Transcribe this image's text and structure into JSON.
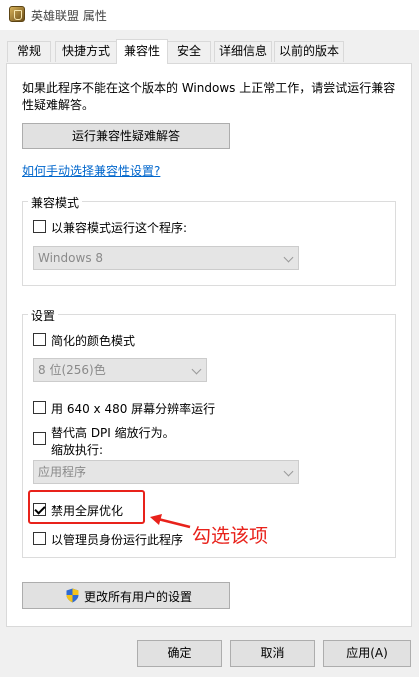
{
  "window": {
    "title": "英雄联盟 属性",
    "app_icon": "lol-icon"
  },
  "tabs": [
    "常规",
    "快捷方式",
    "兼容性",
    "安全",
    "详细信息",
    "以前的版本"
  ],
  "active_tab": "兼容性",
  "description": "如果此程序不能在这个版本的 Windows 上正常工作，请尝试运行兼容性疑难解答。",
  "troubleshooter_button": "运行兼容性疑难解答",
  "manual_link": "如何手动选择兼容性设置?",
  "compat_mode": {
    "group_label": "兼容模式",
    "checkbox_label": "以兼容模式运行这个程序:",
    "checked": false,
    "select_value": "Windows 8"
  },
  "settings": {
    "group_label": "设置",
    "reduced_color": {
      "label": "简化的颜色模式",
      "checked": false,
      "select_value": "8 位(256)色"
    },
    "res_640": {
      "label": "用 640 x 480 屏幕分辨率运行",
      "checked": false
    },
    "dpi": {
      "label_line1": "替代高 DPI 缩放行为。",
      "label_line2": "缩放执行:",
      "checked": false,
      "select_value": "应用程序"
    },
    "disable_fullscreen_opt": {
      "label": "禁用全屏优化",
      "checked": true
    },
    "run_as_admin": {
      "label": "以管理员身份运行此程序",
      "checked": false
    }
  },
  "change_all_users_button": "更改所有用户的设置",
  "annotation": {
    "text": "勾选该项",
    "color": "#e8221b"
  },
  "footer": {
    "ok": "确定",
    "cancel": "取消",
    "apply": "应用(A)"
  }
}
